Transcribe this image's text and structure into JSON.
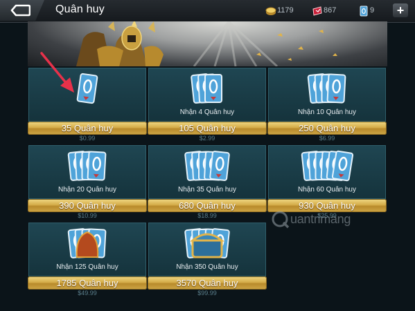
{
  "header": {
    "title": "Quân huy",
    "resources": [
      {
        "name": "gold",
        "value": "1179",
        "icon": "gold-coin-icon"
      },
      {
        "name": "voucher",
        "value": "867",
        "icon": "voucher-icon"
      },
      {
        "name": "quan-huy",
        "value": "9",
        "icon": "quan-huy-icon"
      }
    ],
    "plus_label": "+"
  },
  "packages": [
    {
      "sub": "",
      "button": "35 Quân huy",
      "price": "$0.99",
      "cards": 1
    },
    {
      "sub": "Nhận 4 Quân huy",
      "button": "105 Quân huy",
      "price": "$2.99",
      "cards": 3
    },
    {
      "sub": "Nhận 10 Quân huy",
      "button": "250 Quân huy",
      "price": "$6.99",
      "cards": 4
    },
    {
      "sub": "Nhận 20 Quân huy",
      "button": "390 Quân huy",
      "price": "$10.99",
      "cards": 4
    },
    {
      "sub": "Nhận 35 Quân huy",
      "button": "680 Quân huy",
      "price": "$18.99",
      "cards": 5
    },
    {
      "sub": "Nhận 60 Quân huy",
      "button": "930 Quân huy",
      "price": "$25.99",
      "cards": 6
    },
    {
      "sub": "Nhận 125 Quân huy",
      "button": "1785 Quân huy",
      "price": "$49.99",
      "cards": 4
    },
    {
      "sub": "Nhận 350 Quân huy",
      "button": "3570 Quân huy",
      "price": "$99.99",
      "cards": 5
    }
  ],
  "watermark": "uantrimang",
  "colors": {
    "gold_button": "#d4ac48",
    "card_panel": "#1f4652",
    "card_blue": "#4fa3d9",
    "arrow": "#e8314a"
  }
}
